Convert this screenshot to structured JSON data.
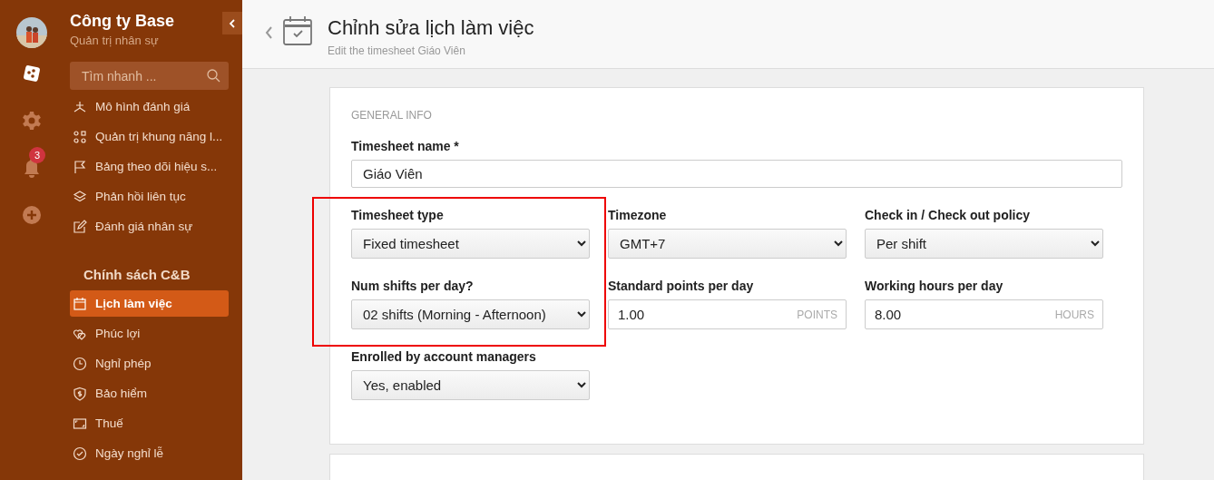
{
  "sidebar": {
    "company": {
      "name": "Công ty Base",
      "subtitle": "Quản trị nhân sự"
    },
    "notification_count": "3",
    "search": {
      "placeholder": "Tìm nhanh ..."
    },
    "items": [
      {
        "label": "Mô hình đánh giá",
        "selected": false
      },
      {
        "label": "Quản trị khung năng l...",
        "selected": false
      },
      {
        "label": "Bảng theo dõi hiệu s...",
        "selected": false
      },
      {
        "label": "Phản hồi liên tục",
        "selected": false
      },
      {
        "label": "Đánh giá nhân sự",
        "selected": false
      }
    ],
    "section": {
      "title": "Chính sách C&B",
      "items": [
        {
          "label": "Lịch làm việc",
          "selected": true
        },
        {
          "label": "Phúc lợi",
          "selected": false
        },
        {
          "label": "Nghỉ phép",
          "selected": false
        },
        {
          "label": "Bảo hiểm",
          "selected": false
        },
        {
          "label": "Thuế",
          "selected": false
        },
        {
          "label": "Ngày nghỉ lễ",
          "selected": false
        }
      ]
    }
  },
  "header": {
    "title": "Chỉnh sửa lịch làm việc",
    "subtitle": "Edit the timesheet Giáo Viên"
  },
  "form": {
    "section_title": "GENERAL INFO",
    "name_field": {
      "label": "Timesheet name *",
      "value": "Giáo Viên"
    },
    "fields": [
      {
        "kind": "select",
        "label": "Timesheet type",
        "value": "Fixed timesheet"
      },
      {
        "kind": "select",
        "label": "Timezone",
        "value": "GMT+7"
      },
      {
        "kind": "select",
        "label": "Check in / Check out policy",
        "value": "Per shift"
      },
      {
        "kind": "select",
        "label": "Num shifts per day?",
        "value": "02 shifts (Morning - Afternoon)"
      },
      {
        "kind": "number",
        "label": "Standard points per day",
        "value": "1.00",
        "unit": "POINTS"
      },
      {
        "kind": "number",
        "label": "Working hours per day",
        "value": "8.00",
        "unit": "HOURS"
      },
      {
        "kind": "select",
        "label": "Enrolled by account managers",
        "value": "Yes, enabled"
      }
    ]
  }
}
